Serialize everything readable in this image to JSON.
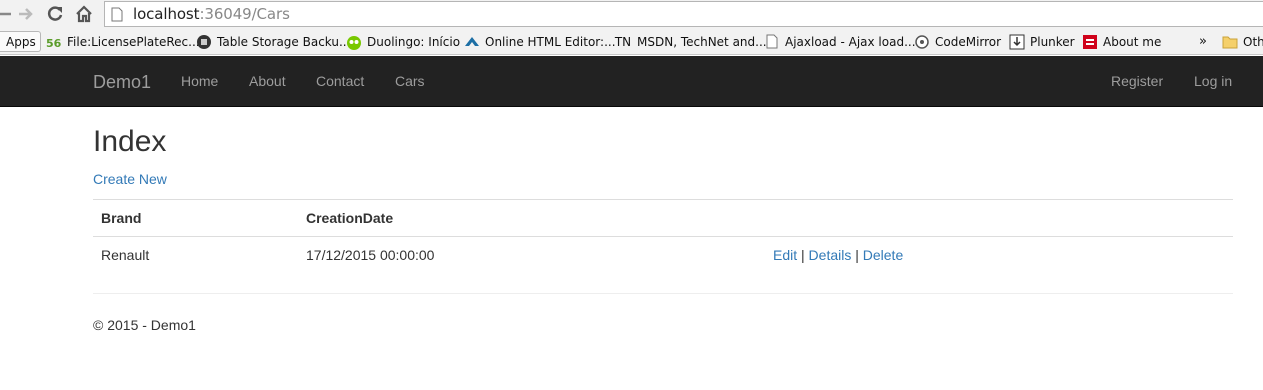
{
  "browser": {
    "url_host": "localhost",
    "url_rest": ":36049/Cars",
    "bookmarks": [
      {
        "label": "Apps",
        "icon": "apps-grid-icon"
      },
      {
        "label": "File:LicensePlateRec...",
        "icon": "wiki-icon"
      },
      {
        "label": "Table Storage Backu...",
        "icon": "storage-icon"
      },
      {
        "label": "Duolingo: Início",
        "icon": "owl-icon"
      },
      {
        "label": "Online HTML Editor:...",
        "icon": "editor-icon"
      },
      {
        "label": "MSDN, TechNet and...",
        "icon": "tn-icon",
        "icon_text": "TN"
      },
      {
        "label": "Ajaxload - Ajax load...",
        "icon": "page-icon"
      },
      {
        "label": "CodeMirror",
        "icon": "codemirror-icon"
      },
      {
        "label": "Plunker",
        "icon": "download-icon"
      },
      {
        "label": "About me",
        "icon": "square-icon"
      }
    ],
    "overflow_label": "»",
    "other_label": "Oth"
  },
  "navbar": {
    "brand": "Demo1",
    "links": [
      "Home",
      "About",
      "Contact",
      "Cars"
    ],
    "right_links": [
      "Register",
      "Log in"
    ]
  },
  "main": {
    "title": "Index",
    "create_link": "Create New",
    "columns": [
      "Brand",
      "CreationDate"
    ],
    "rows": [
      {
        "brand": "Renault",
        "creation_date": "17/12/2015 00:00:00"
      }
    ],
    "actions": {
      "edit": "Edit",
      "details": "Details",
      "delete": "Delete",
      "separator": "|"
    }
  },
  "footer": {
    "text": "© 2015 - Demo1"
  },
  "colors": {
    "navbar_bg": "#222222",
    "nav_text": "#9d9d9d",
    "link": "#337ab7"
  }
}
